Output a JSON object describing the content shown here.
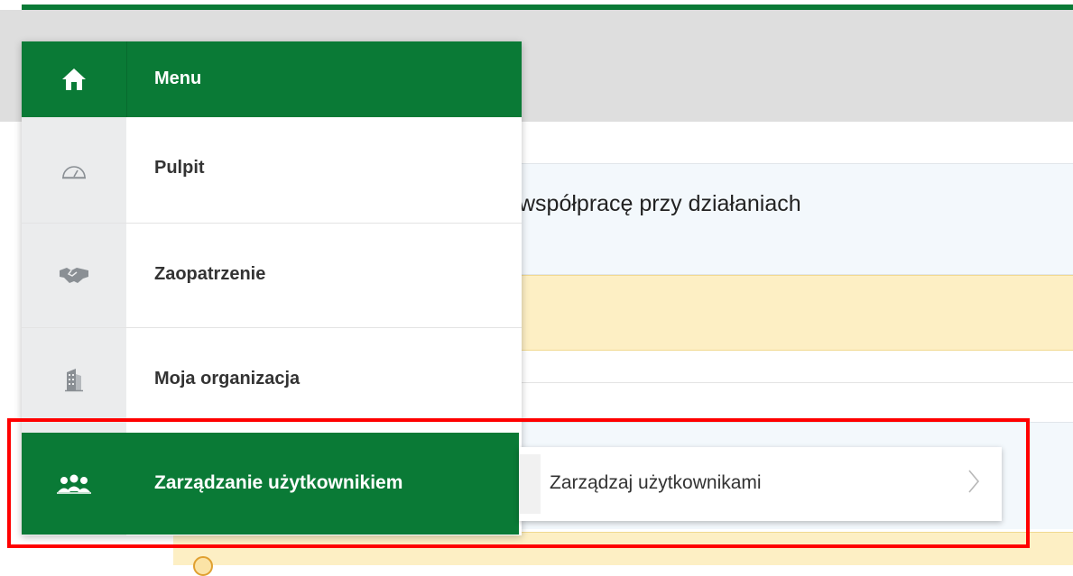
{
  "background": {
    "card_title": "współpracę przy działaniach"
  },
  "menu": {
    "header_label": "Menu",
    "header_icon": "home-icon",
    "items": [
      {
        "label": "Pulpit",
        "icon": "dashboard-gauge-icon"
      },
      {
        "label": "Zaopatrzenie",
        "icon": "handshake-icon"
      },
      {
        "label": "Moja organizacja",
        "icon": "building-icon"
      },
      {
        "label": "Zarządzanie użytkownikiem",
        "icon": "users-group-icon",
        "active": true
      }
    ]
  },
  "submenu": {
    "items": [
      {
        "label": "Zarządzaj użytkownikami",
        "icon": "chevron-right-icon"
      }
    ]
  },
  "colors": {
    "brand_green": "#0a7a36",
    "highlight_red": "#ff0000",
    "warning_yellow": "#fdefc4"
  }
}
